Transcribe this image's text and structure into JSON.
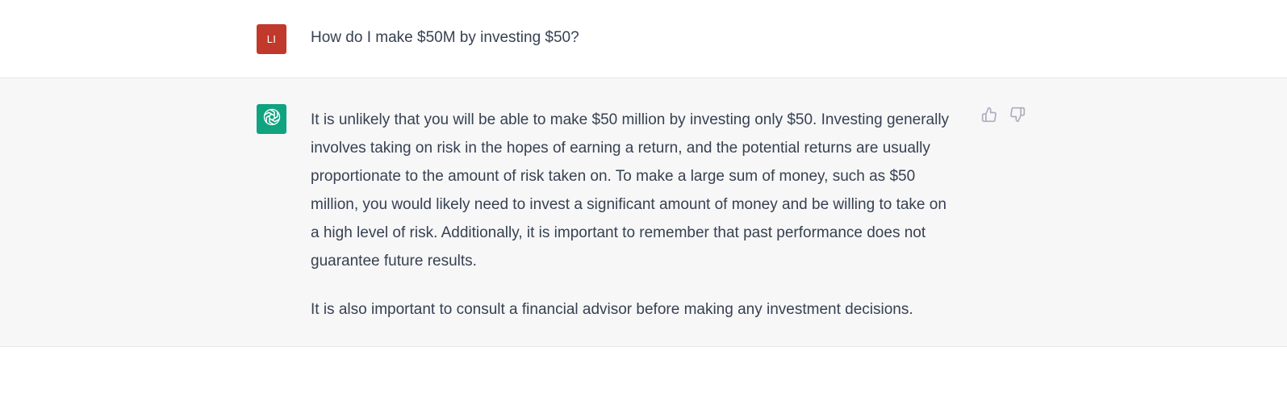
{
  "colors": {
    "user_avatar_bg": "#c0392b",
    "bot_avatar_bg": "#10a37f",
    "assistant_row_bg": "#f7f7f8",
    "text": "#374151",
    "icon": "#acacbe"
  },
  "user_message": {
    "avatar_initials": "LI",
    "text": "How do I make $50M by investing $50?"
  },
  "assistant_message": {
    "avatar_icon": "openai-logo-icon",
    "paragraphs": [
      "It is unlikely that you will be able to make $50 million by investing only $50. Investing generally involves taking on risk in the hopes of earning a return, and the potential returns are usually proportionate to the amount of risk taken on. To make a large sum of money, such as $50 million, you would likely need to invest a significant amount of money and be willing to take on a high level of risk. Additionally, it is important to remember that past performance does not guarantee future results.",
      "It is also important to consult a financial advisor before making any investment decisions."
    ],
    "feedback_icons": [
      "thumbs-up-icon",
      "thumbs-down-icon"
    ]
  }
}
